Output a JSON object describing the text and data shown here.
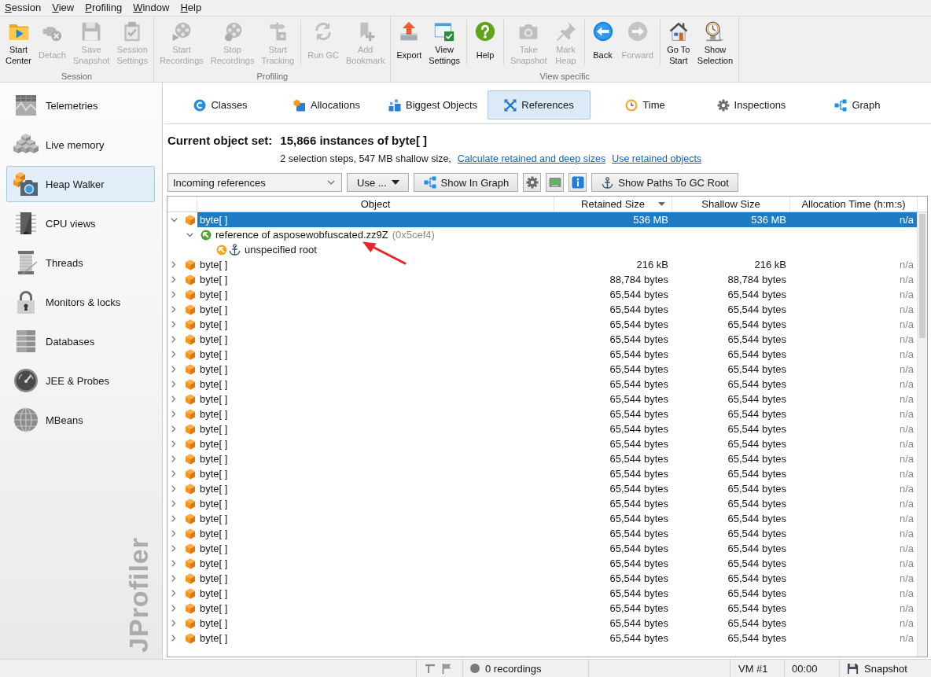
{
  "menu": [
    "Session",
    "View",
    "Profiling",
    "Window",
    "Help"
  ],
  "toolbar": {
    "groups": [
      {
        "label": "Session",
        "sections": [
          {
            "buttons": [
              {
                "label": "Start\nCenter",
                "disabled": false
              },
              {
                "label": "Detach",
                "disabled": true
              },
              {
                "label": "Save\nSnapshot",
                "disabled": true
              },
              {
                "label": "Session\nSettings",
                "disabled": true
              }
            ]
          }
        ]
      },
      {
        "label": "Profiling",
        "sections": [
          {
            "buttons": [
              {
                "label": "Start\nRecordings",
                "disabled": true
              },
              {
                "label": "Stop\nRecordings",
                "disabled": true
              },
              {
                "label": "Start\nTracking",
                "disabled": true
              }
            ]
          },
          {
            "buttons": [
              {
                "label": "Run GC",
                "disabled": true
              },
              {
                "label": "Add\nBookmark",
                "disabled": true
              }
            ]
          }
        ]
      },
      {
        "label": "View specific",
        "sections": [
          {
            "buttons": [
              {
                "label": "Export",
                "disabled": false
              },
              {
                "label": "View\nSettings",
                "disabled": false
              }
            ]
          },
          {
            "buttons": [
              {
                "label": "Help",
                "disabled": false
              }
            ]
          },
          {
            "buttons": [
              {
                "label": "Take\nSnapshot",
                "disabled": true
              },
              {
                "label": "Mark\nHeap",
                "disabled": true
              }
            ]
          },
          {
            "buttons": [
              {
                "label": "Back",
                "disabled": false
              },
              {
                "label": "Forward",
                "disabled": true
              }
            ]
          },
          {
            "buttons": [
              {
                "label": "Go To\nStart",
                "disabled": false
              },
              {
                "label": "Show\nSelection",
                "disabled": false
              }
            ]
          }
        ]
      }
    ]
  },
  "sidebar": {
    "items": [
      {
        "label": "Telemetries",
        "selected": false
      },
      {
        "label": "Live memory",
        "selected": false
      },
      {
        "label": "Heap Walker",
        "selected": true
      },
      {
        "label": "CPU views",
        "selected": false
      },
      {
        "label": "Threads",
        "selected": false
      },
      {
        "label": "Monitors & locks",
        "selected": false
      },
      {
        "label": "Databases",
        "selected": false
      },
      {
        "label": "JEE & Probes",
        "selected": false
      },
      {
        "label": "MBeans",
        "selected": false
      }
    ],
    "logo": "JProfiler"
  },
  "tabs": [
    {
      "label": "Classes",
      "selected": false
    },
    {
      "label": "Allocations",
      "selected": false
    },
    {
      "label": "Biggest Objects",
      "selected": false
    },
    {
      "label": "References",
      "selected": true
    },
    {
      "label": "Time",
      "selected": false
    },
    {
      "label": "Inspections",
      "selected": false
    },
    {
      "label": "Graph",
      "selected": false
    }
  ],
  "object_set": {
    "label": "Current object set:",
    "value": "15,866 instances of byte[ ]",
    "summary": "2 selection steps, 547 MB shallow size,",
    "links": [
      "Calculate retained and deep sizes",
      "Use retained objects"
    ]
  },
  "view_toolbar": {
    "reference_mode": "Incoming references",
    "buttons": [
      {
        "kind": "menu",
        "label": "Use ..."
      },
      {
        "kind": "labeled",
        "label": "Show In Graph"
      },
      {
        "kind": "icon"
      },
      {
        "kind": "icon"
      },
      {
        "kind": "icon"
      },
      {
        "kind": "labeled",
        "label": "Show Paths To GC Root"
      }
    ]
  },
  "table": {
    "columns": [
      {
        "label": "Object",
        "sorted": false
      },
      {
        "label": "Retained Size",
        "sorted": true
      },
      {
        "label": "Shallow Size",
        "sorted": false
      },
      {
        "label": "Allocation Time (h:m:s)",
        "sorted": false
      }
    ],
    "rows": [
      {
        "kind": "object",
        "name": "byte[ ]",
        "retained_size": "536 MB",
        "shallow_size": "536 MB",
        "allocation_time": "n/a",
        "selected": true,
        "expanded": true,
        "children": [
          {
            "kind": "reference",
            "name": "reference of asposewobfuscated.zz9Z",
            "address": "(0x5cef4)",
            "selected": false,
            "expanded": true,
            "children": [
              {
                "kind": "root",
                "name": "unspecified root",
                "selected": false
              }
            ]
          }
        ]
      },
      {
        "kind": "object",
        "name": "byte[ ]",
        "retained_size": "216 kB",
        "shallow_size": "216 kB",
        "allocation_time": "n/a",
        "selected": false,
        "expanded": false
      },
      {
        "kind": "object",
        "name": "byte[ ]",
        "retained_size": "88,784 bytes",
        "shallow_size": "88,784 bytes",
        "allocation_time": "n/a",
        "selected": false,
        "expanded": false
      },
      {
        "kind": "object",
        "name": "byte[ ]",
        "retained_size": "65,544 bytes",
        "shallow_size": "65,544 bytes",
        "allocation_time": "n/a",
        "selected": false,
        "expanded": false
      },
      {
        "kind": "object",
        "name": "byte[ ]",
        "retained_size": "65,544 bytes",
        "shallow_size": "65,544 bytes",
        "allocation_time": "n/a",
        "selected": false,
        "expanded": false
      },
      {
        "kind": "object",
        "name": "byte[ ]",
        "retained_size": "65,544 bytes",
        "shallow_size": "65,544 bytes",
        "allocation_time": "n/a",
        "selected": false,
        "expanded": false
      },
      {
        "kind": "object",
        "name": "byte[ ]",
        "retained_size": "65,544 bytes",
        "shallow_size": "65,544 bytes",
        "allocation_time": "n/a",
        "selected": false,
        "expanded": false
      },
      {
        "kind": "object",
        "name": "byte[ ]",
        "retained_size": "65,544 bytes",
        "shallow_size": "65,544 bytes",
        "allocation_time": "n/a",
        "selected": false,
        "expanded": false
      },
      {
        "kind": "object",
        "name": "byte[ ]",
        "retained_size": "65,544 bytes",
        "shallow_size": "65,544 bytes",
        "allocation_time": "n/a",
        "selected": false,
        "expanded": false
      },
      {
        "kind": "object",
        "name": "byte[ ]",
        "retained_size": "65,544 bytes",
        "shallow_size": "65,544 bytes",
        "allocation_time": "n/a",
        "selected": false,
        "expanded": false
      },
      {
        "kind": "object",
        "name": "byte[ ]",
        "retained_size": "65,544 bytes",
        "shallow_size": "65,544 bytes",
        "allocation_time": "n/a",
        "selected": false,
        "expanded": false
      },
      {
        "kind": "object",
        "name": "byte[ ]",
        "retained_size": "65,544 bytes",
        "shallow_size": "65,544 bytes",
        "allocation_time": "n/a",
        "selected": false,
        "expanded": false
      },
      {
        "kind": "object",
        "name": "byte[ ]",
        "retained_size": "65,544 bytes",
        "shallow_size": "65,544 bytes",
        "allocation_time": "n/a",
        "selected": false,
        "expanded": false
      },
      {
        "kind": "object",
        "name": "byte[ ]",
        "retained_size": "65,544 bytes",
        "shallow_size": "65,544 bytes",
        "allocation_time": "n/a",
        "selected": false,
        "expanded": false
      },
      {
        "kind": "object",
        "name": "byte[ ]",
        "retained_size": "65,544 bytes",
        "shallow_size": "65,544 bytes",
        "allocation_time": "n/a",
        "selected": false,
        "expanded": false
      },
      {
        "kind": "object",
        "name": "byte[ ]",
        "retained_size": "65,544 bytes",
        "shallow_size": "65,544 bytes",
        "allocation_time": "n/a",
        "selected": false,
        "expanded": false
      },
      {
        "kind": "object",
        "name": "byte[ ]",
        "retained_size": "65,544 bytes",
        "shallow_size": "65,544 bytes",
        "allocation_time": "n/a",
        "selected": false,
        "expanded": false
      },
      {
        "kind": "object",
        "name": "byte[ ]",
        "retained_size": "65,544 bytes",
        "shallow_size": "65,544 bytes",
        "allocation_time": "n/a",
        "selected": false,
        "expanded": false
      },
      {
        "kind": "object",
        "name": "byte[ ]",
        "retained_size": "65,544 bytes",
        "shallow_size": "65,544 bytes",
        "allocation_time": "n/a",
        "selected": false,
        "expanded": false
      },
      {
        "kind": "object",
        "name": "byte[ ]",
        "retained_size": "65,544 bytes",
        "shallow_size": "65,544 bytes",
        "allocation_time": "n/a",
        "selected": false,
        "expanded": false
      },
      {
        "kind": "object",
        "name": "byte[ ]",
        "retained_size": "65,544 bytes",
        "shallow_size": "65,544 bytes",
        "allocation_time": "n/a",
        "selected": false,
        "expanded": false
      },
      {
        "kind": "object",
        "name": "byte[ ]",
        "retained_size": "65,544 bytes",
        "shallow_size": "65,544 bytes",
        "allocation_time": "n/a",
        "selected": false,
        "expanded": false
      },
      {
        "kind": "object",
        "name": "byte[ ]",
        "retained_size": "65,544 bytes",
        "shallow_size": "65,544 bytes",
        "allocation_time": "n/a",
        "selected": false,
        "expanded": false
      },
      {
        "kind": "object",
        "name": "byte[ ]",
        "retained_size": "65,544 bytes",
        "shallow_size": "65,544 bytes",
        "allocation_time": "n/a",
        "selected": false,
        "expanded": false
      },
      {
        "kind": "object",
        "name": "byte[ ]",
        "retained_size": "65,544 bytes",
        "shallow_size": "65,544 bytes",
        "allocation_time": "n/a",
        "selected": false,
        "expanded": false
      },
      {
        "kind": "object",
        "name": "byte[ ]",
        "retained_size": "65,544 bytes",
        "shallow_size": "65,544 bytes",
        "allocation_time": "n/a",
        "selected": false,
        "expanded": false
      },
      {
        "kind": "object",
        "name": "byte[ ]",
        "retained_size": "65,544 bytes",
        "shallow_size": "65,544 bytes",
        "allocation_time": "n/a",
        "selected": false,
        "expanded": false
      }
    ]
  },
  "status_bar": {
    "recordings": "0 recordings",
    "vm": "VM #1",
    "time": "00:00",
    "mode": "Snapshot"
  }
}
